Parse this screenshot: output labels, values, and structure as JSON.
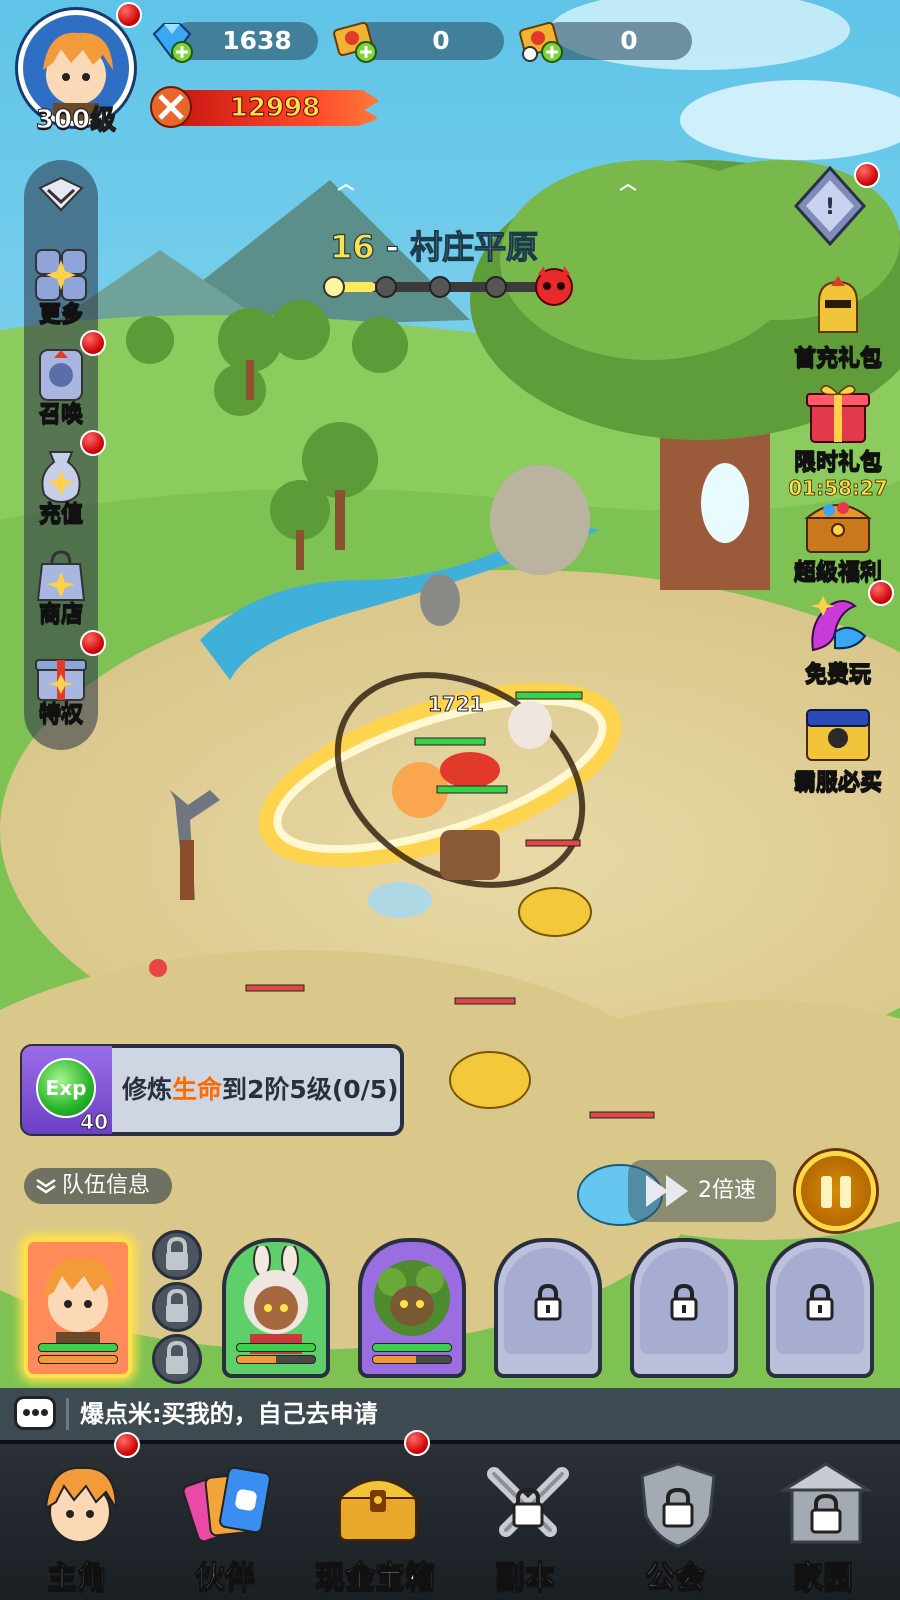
{
  "player": {
    "level": "300级",
    "has_notification": true
  },
  "resources": [
    {
      "name": "diamond",
      "icon": "diamond-icon",
      "value": "1638"
    },
    {
      "name": "ticket",
      "icon": "ticket-icon",
      "value": "0"
    },
    {
      "name": "timed-ticket",
      "icon": "timed-ticket-icon",
      "value": "0"
    }
  ],
  "combat_power": {
    "icon": "swords-icon",
    "value": "12998"
  },
  "stage": {
    "number": "16",
    "separator": " - ",
    "name": "村庄平原",
    "progress": {
      "nodes_total": 5,
      "nodes_cleared": 1,
      "boss": "devil-skull-icon"
    }
  },
  "left_menu": [
    {
      "label": "更多",
      "icon": "more-icon",
      "badge": false
    },
    {
      "label": "召唤",
      "icon": "summon-icon",
      "badge": true
    },
    {
      "label": "充值",
      "icon": "recharge-icon",
      "badge": true
    },
    {
      "label": "商店",
      "icon": "shop-icon",
      "badge": false
    },
    {
      "label": "特权",
      "icon": "privilege-gift-icon",
      "badge": true
    }
  ],
  "right_menu": {
    "top_icon": {
      "icon": "diamond-badge-icon",
      "badge": true
    },
    "items": [
      {
        "label": "首充礼包",
        "icon": "golden-knight-icon",
        "badge": false
      },
      {
        "label": "限时礼包",
        "icon": "gift-box-icon",
        "badge": false,
        "timer": "01:58:27"
      },
      {
        "label": "超级福利",
        "icon": "treasure-chest-icon",
        "badge": false
      },
      {
        "label": "免费玩",
        "icon": "free-play-icon",
        "badge": true
      },
      {
        "label": "霸服必买",
        "icon": "locked-chest-icon",
        "badge": false
      }
    ]
  },
  "battle": {
    "damage_number": "1721"
  },
  "quest": {
    "exp_count": "40",
    "exp_label": "Exp",
    "text_pre": "修炼",
    "text_highlight": "生命",
    "text_post": "到2阶5级(0/5)"
  },
  "team_info_label": "队伍信息",
  "speed_label": "2倍速",
  "team": [
    {
      "slot": "hero-main",
      "locked": false,
      "hp": 1.0,
      "energy": 1.0
    },
    {
      "slot": "hero-bunny-girl",
      "locked": false,
      "hp": 1.0,
      "energy": 0.5
    },
    {
      "slot": "hero-tree-golem",
      "locked": false,
      "hp": 1.0,
      "energy": 0.55
    },
    {
      "slot": "empty-4",
      "locked": true
    },
    {
      "slot": "empty-5",
      "locked": true
    },
    {
      "slot": "empty-6",
      "locked": true
    }
  ],
  "chat": {
    "message": "爆点米:买我的，自己去申请"
  },
  "bottom_nav": [
    {
      "label": "主角",
      "icon": "hero-face-icon",
      "badge": true,
      "locked": false
    },
    {
      "label": "伙伴",
      "icon": "partner-cards-icon",
      "badge": false,
      "locked": false
    },
    {
      "label": "现金宝箱",
      "icon": "cash-chest-icon",
      "badge": true,
      "locked": false
    },
    {
      "label": "副本",
      "icon": "dungeon-swords-icon",
      "badge": false,
      "locked": true
    },
    {
      "label": "公会",
      "icon": "guild-shield-icon",
      "badge": false,
      "locked": true
    },
    {
      "label": "家园",
      "icon": "home-building-icon",
      "badge": false,
      "locked": true
    }
  ],
  "colors": {
    "accent_gold": "#ffe24a",
    "badge_red": "#d40b0b",
    "highlight_orange": "#ff6a00"
  }
}
